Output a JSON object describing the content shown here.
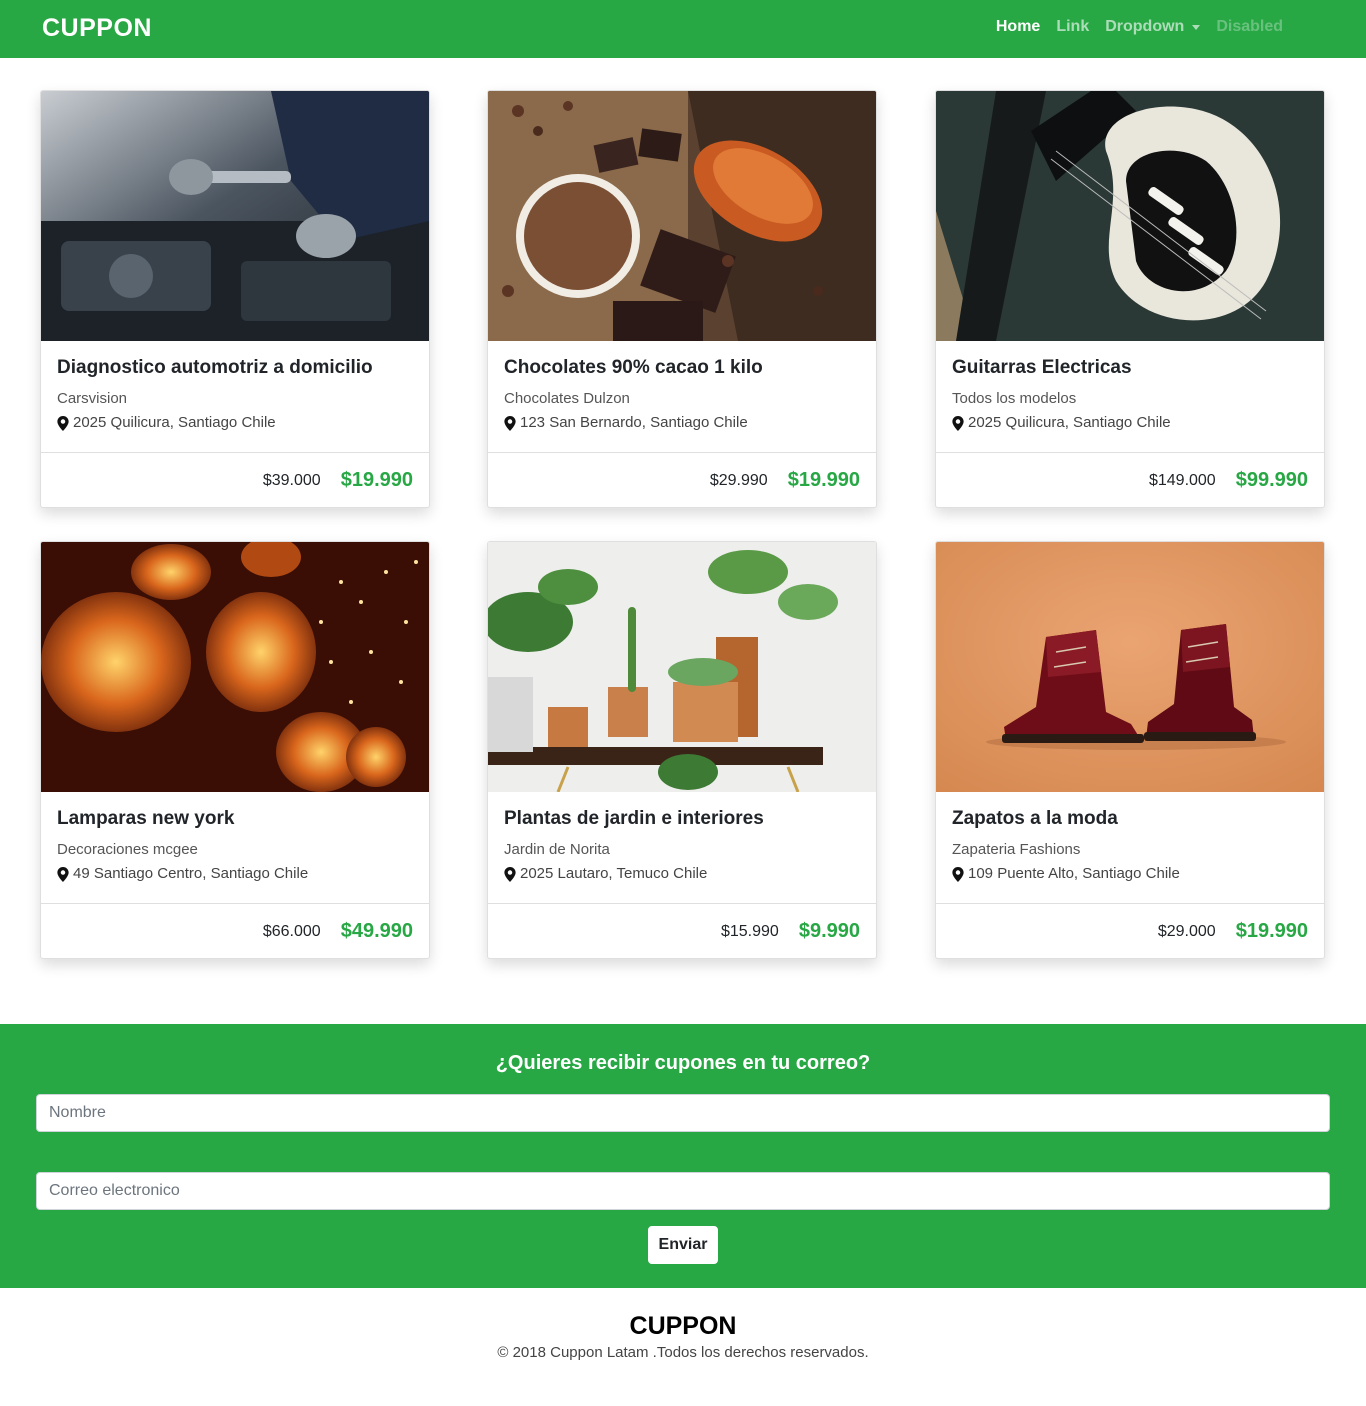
{
  "navbar": {
    "brand": "CUPPON",
    "links": [
      {
        "label": "Home"
      },
      {
        "label": "Link"
      },
      {
        "label": "Dropdown"
      },
      {
        "label": "Disabled"
      }
    ]
  },
  "cards": [
    {
      "title": "Diagnostico automotriz a domicilio",
      "company": "Carsvision",
      "address": "2025 Quilicura, Santiago Chile",
      "old_price": "$39.000",
      "new_price": "$19.990",
      "image": "mechanic-engine"
    },
    {
      "title": "Chocolates 90% cacao 1 kilo",
      "company": "Chocolates Dulzon",
      "address": "123 San Bernardo, Santiago Chile",
      "old_price": "$29.990",
      "new_price": "$19.990",
      "image": "cacao-chocolate"
    },
    {
      "title": "Guitarras Electricas",
      "company": "Todos los modelos",
      "address": "2025 Quilicura, Santiago Chile",
      "old_price": "$149.000",
      "new_price": "$99.990",
      "image": "electric-guitar"
    },
    {
      "title": "Lamparas new york",
      "company": "Decoraciones mcgee",
      "address": "49 Santiago Centro, Santiago Chile",
      "old_price": "$66.000",
      "new_price": "$49.990",
      "image": "wicker-lamps"
    },
    {
      "title": "Plantas de jardin e interiores",
      "company": "Jardin de Norita",
      "address": "2025 Lautaro, Temuco Chile",
      "old_price": "$15.990",
      "new_price": "$9.990",
      "image": "potted-plants"
    },
    {
      "title": "Zapatos a la moda",
      "company": "Zapateria Fashions",
      "address": "109 Puente Alto, Santiago Chile",
      "old_price": "$29.000",
      "new_price": "$19.990",
      "image": "red-boots"
    }
  ],
  "subscribe": {
    "title": "¿Quieres recibir cupones en tu correo?",
    "name_placeholder": "Nombre",
    "email_placeholder": "Correo electronico",
    "submit_label": "Enviar"
  },
  "footer": {
    "brand": "CUPPON",
    "copyright": "© 2018 Cuppon Latam .Todos los derechos reservados."
  },
  "colors": {
    "primary_green": "#28a745",
    "price_green": "#28a745"
  }
}
